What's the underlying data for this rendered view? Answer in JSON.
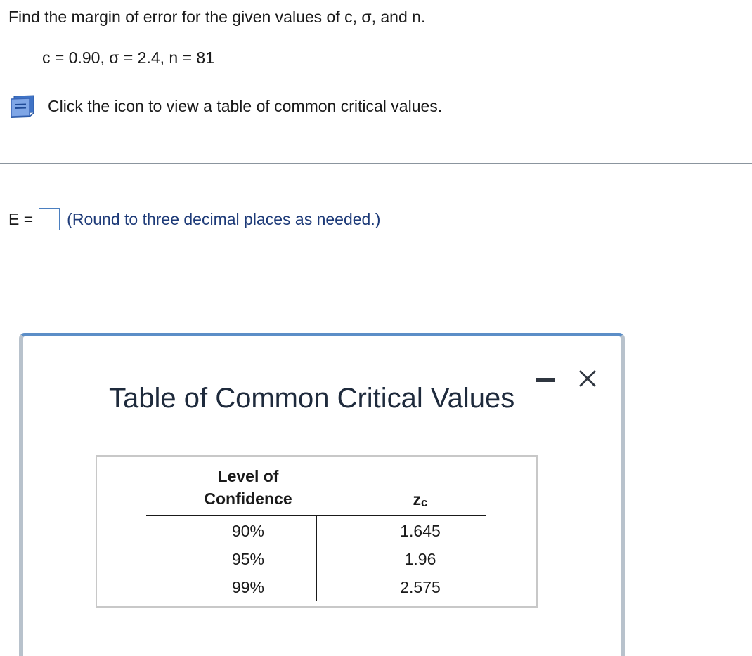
{
  "question": {
    "prompt": "Find the margin of error for the given values of c, σ, and n.",
    "givens": "c = 0.90, σ = 2.4, n = 81",
    "hint": "Click the icon to view a table of common critical values.",
    "hint_icon": "book-icon"
  },
  "answer": {
    "label": "E =",
    "value": "",
    "note": "(Round to three decimal places as needed.)"
  },
  "dialog": {
    "title": "Table of Common Critical Values",
    "minimize_icon": "minimize-icon",
    "close_icon": "close-icon",
    "table": {
      "headers": {
        "confidence": "Level of\nConfidence",
        "z_main": "z",
        "z_sub": "c"
      },
      "rows": [
        {
          "confidence": "90%",
          "z": "1.645"
        },
        {
          "confidence": "95%",
          "z": "1.96"
        },
        {
          "confidence": "99%",
          "z": "2.575"
        }
      ]
    }
  },
  "colors": {
    "accent_blue": "#5c8ec7",
    "note_text": "#1d3a78",
    "input_border": "#4b7fc0"
  }
}
